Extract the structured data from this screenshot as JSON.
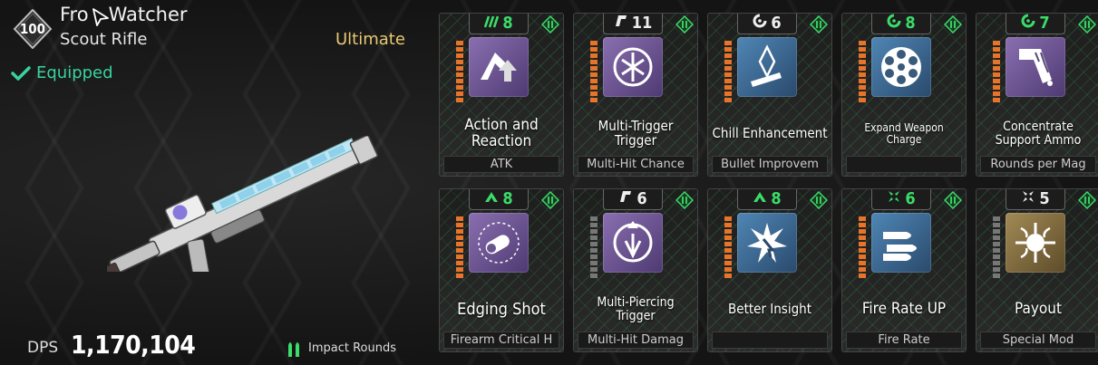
{
  "weapon": {
    "level": "100",
    "name": "Fro",
    "name_rest": "Watcher",
    "type": "Scout Rifle",
    "rarity": "Ultimate",
    "equipped_label": "Equipped",
    "dps_label": "DPS",
    "dps_value": "1,170,104",
    "ammo_type": "Impact Rounds"
  },
  "mods": [
    {
      "cost": "8",
      "cost_color": "green",
      "cost_icon": "triple-bar-icon",
      "bar_color": "orange",
      "icon_bg": "purple",
      "icon": "action-reaction-icon",
      "name": "Action and Reaction",
      "name_size": "17px",
      "stat": "ATK"
    },
    {
      "cost": "11",
      "cost_color": "white",
      "cost_icon": "trigger-icon",
      "bar_color": "orange",
      "icon_bg": "purple",
      "icon": "multi-trigger-icon",
      "name": "Multi-Trigger Trigger",
      "name_size": "15px",
      "stat": "Multi-Hit Chance"
    },
    {
      "cost": "6",
      "cost_color": "white",
      "cost_icon": "c-icon",
      "bar_color": "orange",
      "icon_bg": "blue",
      "icon": "chill-icon",
      "name": "Chill Enhancement",
      "name_size": "15px",
      "stat": "Bullet Improvem"
    },
    {
      "cost": "8",
      "cost_color": "green",
      "cost_icon": "c-icon",
      "bar_color": "orange",
      "icon_bg": "blue",
      "icon": "revolver-cylinder-icon",
      "name": "Expand Weapon Charge",
      "name_size": "12px",
      "stat": ""
    },
    {
      "cost": "7",
      "cost_color": "green",
      "cost_icon": "c-icon",
      "bar_color": "orange",
      "icon_bg": "purple",
      "icon": "ammo-belt-icon",
      "name": "Concentrate Support Ammo",
      "name_size": "14px",
      "stat": "Rounds per Mag"
    },
    {
      "cost": "8",
      "cost_color": "green",
      "cost_icon": "chevron-icon",
      "bar_color": "orange",
      "icon_bg": "purple",
      "icon": "edging-shot-icon",
      "name": "Edging Shot",
      "name_size": "18px",
      "stat": "Firearm Critical H"
    },
    {
      "cost": "6",
      "cost_color": "white",
      "cost_icon": "trigger-icon",
      "bar_color": "grey",
      "icon_bg": "purple",
      "icon": "multi-piercing-icon",
      "name": "Multi-Piercing Trigger",
      "name_size": "14px",
      "stat": "Multi-Hit Damag"
    },
    {
      "cost": "8",
      "cost_color": "green",
      "cost_icon": "chevron-icon",
      "bar_color": "orange",
      "icon_bg": "blue",
      "icon": "insight-icon",
      "name": "Better Insight",
      "name_size": "15px",
      "stat": ""
    },
    {
      "cost": "6",
      "cost_color": "green",
      "cost_icon": "cross-icon",
      "bar_color": "orange",
      "icon_bg": "blue",
      "icon": "bullets-icon",
      "name": "Fire Rate UP",
      "name_size": "17px",
      "stat": "Fire Rate"
    },
    {
      "cost": "5",
      "cost_color": "white",
      "cost_icon": "cross-icon",
      "bar_color": "grey",
      "icon_bg": "gold",
      "icon": "payout-icon",
      "name": "Payout",
      "name_size": "17px",
      "stat": "Special Mod"
    }
  ],
  "colors": {
    "accent_green": "#3cdc6a",
    "rarity_gold": "#e8c872",
    "equipped_green": "#38d39f",
    "bar_orange": "#e8742a"
  }
}
